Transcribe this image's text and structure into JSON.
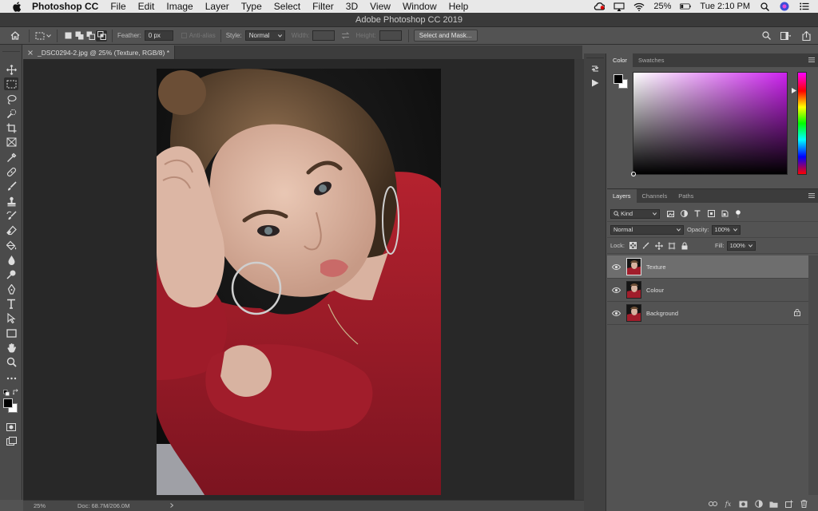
{
  "menubar": {
    "app_name": "Photoshop CC",
    "items": [
      "File",
      "Edit",
      "Image",
      "Layer",
      "Type",
      "Select",
      "Filter",
      "3D",
      "View",
      "Window",
      "Help"
    ],
    "battery": "25%",
    "clock": "Tue 2:10 PM"
  },
  "window": {
    "title": "Adobe Photoshop CC 2019"
  },
  "options": {
    "feather_label": "Feather:",
    "feather_value": "0 px",
    "antialias_label": "Anti-alias",
    "style_label": "Style:",
    "style_value": "Normal",
    "width_label": "Width:",
    "height_label": "Height:",
    "select_mask_label": "Select and Mask..."
  },
  "document": {
    "tab_title": "_DSC0294-2.jpg @ 25% (Texture, RGB/8) *",
    "zoom": "25%",
    "doc_size": "Doc: 68.7M/206.0M"
  },
  "color_panel": {
    "tabs": [
      "Color",
      "Swatches"
    ],
    "foreground": "#000000",
    "background": "#ffffff"
  },
  "layers_panel": {
    "tabs": [
      "Layers",
      "Channels",
      "Paths"
    ],
    "kind_label": "Kind",
    "blend_mode": "Normal",
    "opacity_label": "Opacity:",
    "opacity_value": "100%",
    "lock_label": "Lock:",
    "fill_label": "Fill:",
    "fill_value": "100%",
    "layers": [
      {
        "name": "Texture",
        "selected": true
      },
      {
        "name": "Colour",
        "selected": false
      },
      {
        "name": "Background",
        "selected": false,
        "locked": true
      }
    ]
  },
  "colors": {
    "accent_shirt": "#a4202e",
    "ui_panel": "#535353"
  }
}
